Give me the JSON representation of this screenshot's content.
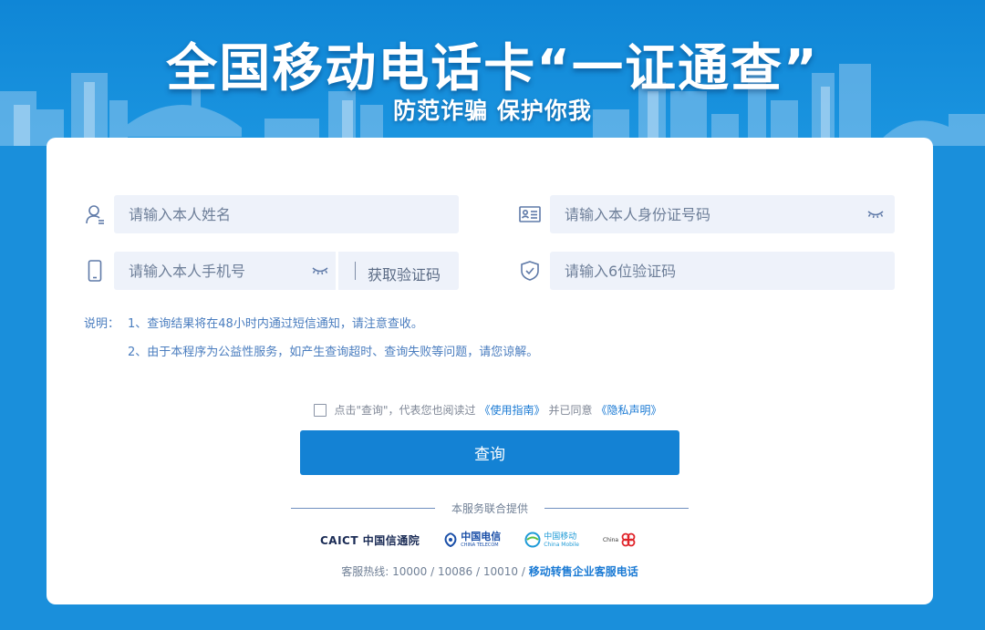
{
  "banner": {
    "title": "全国移动电话卡“一证通查”",
    "subtitle": "防范诈骗 保护你我"
  },
  "form": {
    "name_placeholder": "请输入本人姓名",
    "id_placeholder": "请输入本人身份证号码",
    "phone_placeholder": "请输入本人手机号",
    "get_code_label": "获取验证码",
    "code_placeholder": "请输入6位验证码"
  },
  "notes": {
    "label": "说明：",
    "line1": "1、查询结果将在48小时内通过短信通知，请注意查收。",
    "line2": "2、由于本程序为公益性服务，如产生查询超时、查询失败等问题，请您谅解。"
  },
  "agreement": {
    "prefix": "点击\"查询\"，代表您也阅读过",
    "guide_link": "《使用指南》",
    "middle": "并已同意",
    "privacy_link": "《隐私声明》"
  },
  "query_button": "查询",
  "providers": {
    "title": "本服务联合提供",
    "logos": [
      {
        "icon": "caict-logo",
        "text": "CAICT 中国信通院"
      },
      {
        "icon": "china-telecom-logo",
        "text": "中国电信",
        "sub": "CHINA TELECOM"
      },
      {
        "icon": "china-mobile-logo",
        "text": "中国移动",
        "sub": "China Mobile"
      },
      {
        "icon": "china-unicom-logo",
        "text": "China"
      }
    ]
  },
  "hotline": {
    "prefix": "客服热线: 10000 / 10086 / 10010 /",
    "link": "移动转售企业客服电话"
  },
  "colors": {
    "background": "#1a8fdb",
    "button": "#1482d4",
    "field": "#eef2fa",
    "link": "#1a7ad4"
  }
}
